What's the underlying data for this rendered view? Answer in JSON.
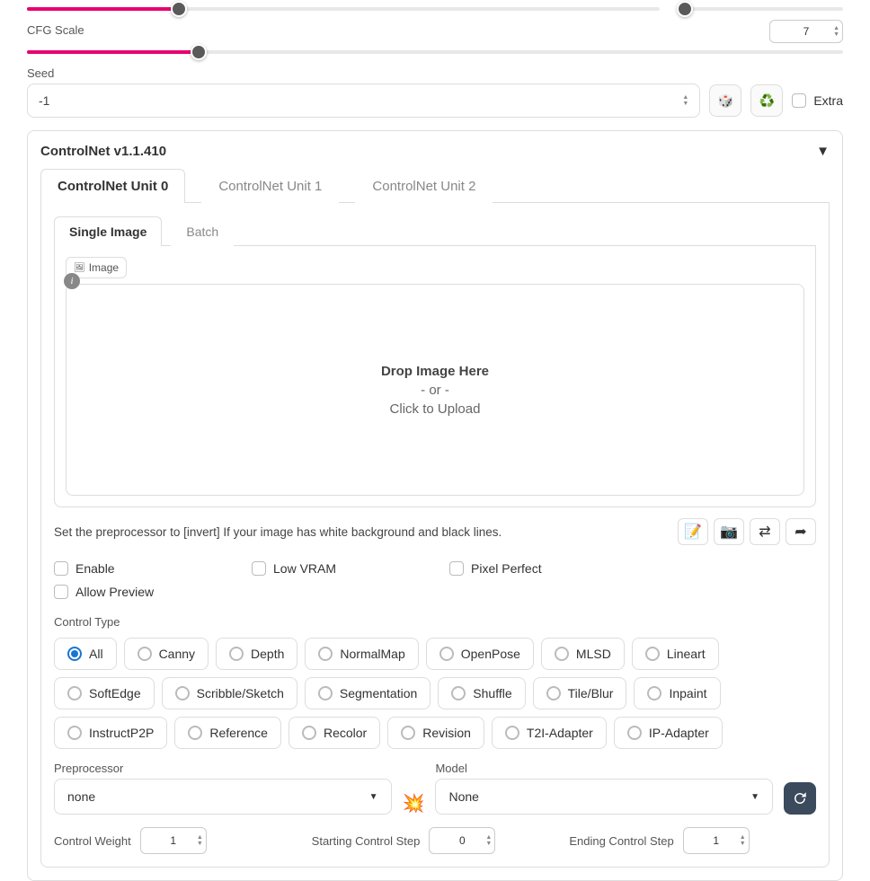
{
  "top_slider_fill_pct": 24,
  "top_right_fill_pct": 2,
  "cfg": {
    "label": "CFG Scale",
    "value": "7",
    "fill_pct": 21
  },
  "seed": {
    "label": "Seed",
    "value": "-1",
    "extra_label": "Extra"
  },
  "controlnet": {
    "title": "ControlNet v1.1.410",
    "tabs": [
      "ControlNet Unit 0",
      "ControlNet Unit 1",
      "ControlNet Unit 2"
    ],
    "subtabs": [
      "Single Image",
      "Batch"
    ],
    "image_tag": "Image",
    "drop1": "Drop Image Here",
    "drop2": "- or -",
    "drop3": "Click to Upload",
    "hint": "Set the preprocessor to [invert] If your image has white background and black lines.",
    "checks": [
      {
        "label": "Enable"
      },
      {
        "label": "Low VRAM"
      },
      {
        "label": "Pixel Perfect"
      },
      {
        "label": "Allow Preview"
      }
    ],
    "control_type_label": "Control Type",
    "control_types": [
      "All",
      "Canny",
      "Depth",
      "NormalMap",
      "OpenPose",
      "MLSD",
      "Lineart",
      "SoftEdge",
      "Scribble/Sketch",
      "Segmentation",
      "Shuffle",
      "Tile/Blur",
      "Inpaint",
      "InstructP2P",
      "Reference",
      "Recolor",
      "Revision",
      "T2I-Adapter",
      "IP-Adapter"
    ],
    "control_type_selected": "All",
    "preprocessor_label": "Preprocessor",
    "preprocessor_value": "none",
    "model_label": "Model",
    "model_value": "None",
    "weight_label": "Control Weight",
    "weight_value": "1",
    "start_label": "Starting Control Step",
    "start_value": "0",
    "end_label": "Ending Control Step",
    "end_value": "1"
  }
}
